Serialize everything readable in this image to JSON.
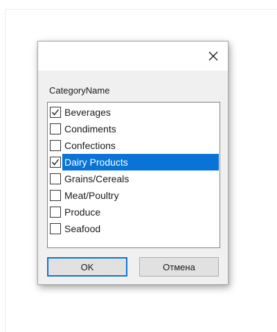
{
  "dialog": {
    "close_icon": "close-icon",
    "field_label": "CategoryName",
    "items": [
      {
        "label": "Beverages",
        "checked": true,
        "selected": false
      },
      {
        "label": "Condiments",
        "checked": false,
        "selected": false
      },
      {
        "label": "Confections",
        "checked": false,
        "selected": false
      },
      {
        "label": "Dairy Products",
        "checked": true,
        "selected": true
      },
      {
        "label": "Grains/Cereals",
        "checked": false,
        "selected": false
      },
      {
        "label": "Meat/Poultry",
        "checked": false,
        "selected": false
      },
      {
        "label": "Produce",
        "checked": false,
        "selected": false
      },
      {
        "label": "Seafood",
        "checked": false,
        "selected": false
      }
    ],
    "ok_label": "OK",
    "cancel_label": "Отмена"
  },
  "colors": {
    "selection": "#0a74d6",
    "dialog_background": "#f0f0f0",
    "titlebar": "#ffffff"
  }
}
